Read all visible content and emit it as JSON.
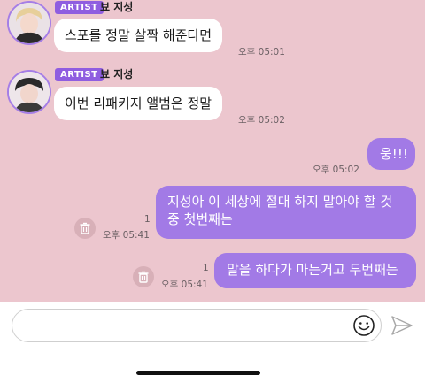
{
  "messages_in": [
    {
      "badge": "ARTIST",
      "sender": "뵤 지성",
      "text": "스포를 정말 살짝 해준다면",
      "time": "오후 05:01"
    },
    {
      "badge": "ARTIST",
      "sender": "뵤 지성",
      "text": "이번 리패키지 앨범은 정말",
      "time": "오후 05:02"
    }
  ],
  "messages_out": [
    {
      "lines": [
        "웅!!!"
      ],
      "time": "오후 05:02",
      "read_count": ""
    },
    {
      "lines": [
        "지성아 이 세상에 절대 하지 말아야 할 것",
        "중 첫번째는"
      ],
      "time": "오후 05:41",
      "read_count": "1"
    },
    {
      "lines": [
        "말을 하다가 마는거고 두번째는"
      ],
      "time": "오후 05:41",
      "read_count": "1"
    }
  ],
  "input": {
    "value": "",
    "placeholder": ""
  },
  "icons": {
    "emoji": "smiley-icon",
    "send": "paper-plane-icon",
    "delete": "trash-icon"
  },
  "colors": {
    "chat_background": "#ecc6ce",
    "outgoing_bubble": "#a27ae6",
    "artist_badge": "#8f5de0",
    "avatar_ring": "#a57ee6"
  }
}
